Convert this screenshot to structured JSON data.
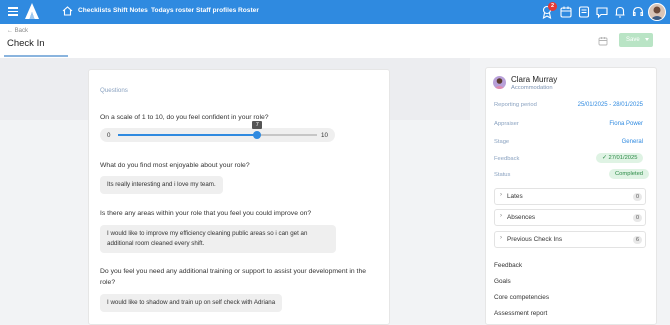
{
  "nav": {
    "links": [
      "Checklists",
      "Shift Notes",
      "Todays roster",
      "Staff profiles",
      "Roster"
    ],
    "notification_count": "2",
    "accent": "#2f8ae0"
  },
  "header": {
    "back_label": "Back",
    "title": "Check In",
    "save_label": "Save"
  },
  "questions": {
    "heading": "Questions",
    "q1": {
      "text": "On a scale of 1 to 10, do you feel confident in your role?",
      "min": "0",
      "max": "10",
      "value": "7",
      "fraction": 0.7
    },
    "q2": {
      "text": "What do you find most enjoyable about your role?",
      "answer": "Its really interesting and i love my team."
    },
    "q3": {
      "text": "Is there any areas within your role that you feel you could improve on?",
      "answer": "I would like to improve my efficiency cleaning public areas so i can get an additional room cleaned every shift."
    },
    "q4": {
      "text": "Do you feel you need any additional training or support to assist your development in the role?",
      "answer": "I would like to shadow and train up on self check with Adriana"
    }
  },
  "profile": {
    "name": "Clara Murray",
    "role": "Accommodation",
    "reporting_period_label": "Reporting period",
    "reporting_period": "25/01/2025 - 28/01/2025",
    "appraiser_label": "Appraiser",
    "appraiser": "Fiona Power",
    "stage_label": "Stage",
    "stage": "General",
    "feedback_label": "Feedback",
    "feedback_date": "27/01/2025",
    "status_label": "Status",
    "status": "Completed"
  },
  "sections": [
    {
      "label": "Lates",
      "count": "0"
    },
    {
      "label": "Absences",
      "count": "0"
    },
    {
      "label": "Previous Check Ins",
      "count": "6"
    }
  ],
  "links": [
    "Feedback",
    "Goals",
    "Core competencies",
    "Assessment report"
  ]
}
